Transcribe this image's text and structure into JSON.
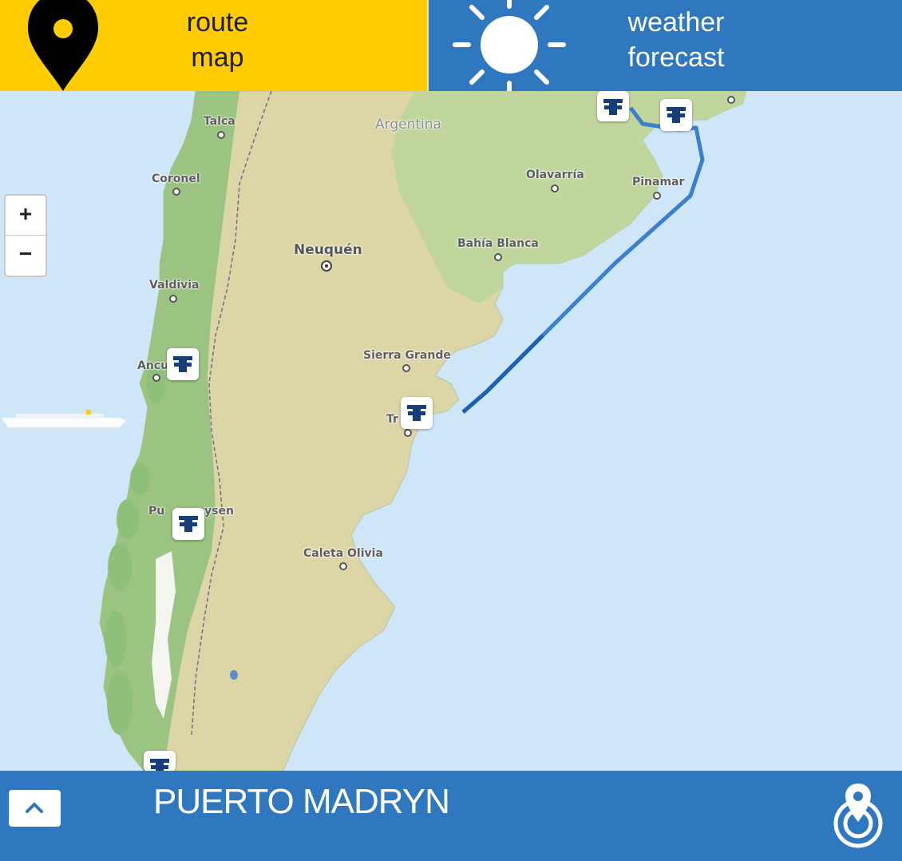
{
  "header": {
    "route_tab": {
      "line1": "route",
      "line2": "map",
      "icon": "map-pin-icon",
      "color": "#ffcc00"
    },
    "weather_tab": {
      "line1": "weather",
      "line2": "forecast",
      "icon": "sun-icon",
      "color": "#2f78bf"
    }
  },
  "map": {
    "country": "Argentina",
    "places": [
      "Talca",
      "Coronel",
      "Valdivia",
      "Neuquén",
      "Olavarría",
      "Pinamar",
      "Bahía Blanca",
      "Sierra Grande",
      "Ancu",
      "Tr",
      "Pu",
      "ysen",
      "Caleta Olivia"
    ],
    "route_color": "#3a7fd0",
    "port_icon": "port-bollard-icon",
    "ship_icon": "cruise-ship-icon"
  },
  "zoom": {
    "in": "+",
    "out": "−"
  },
  "footer": {
    "port_name": "PUERTO MADRYN",
    "up_icon": "chevron-up-icon",
    "locate_icon": "location-target-icon",
    "color": "#2f78bf"
  }
}
